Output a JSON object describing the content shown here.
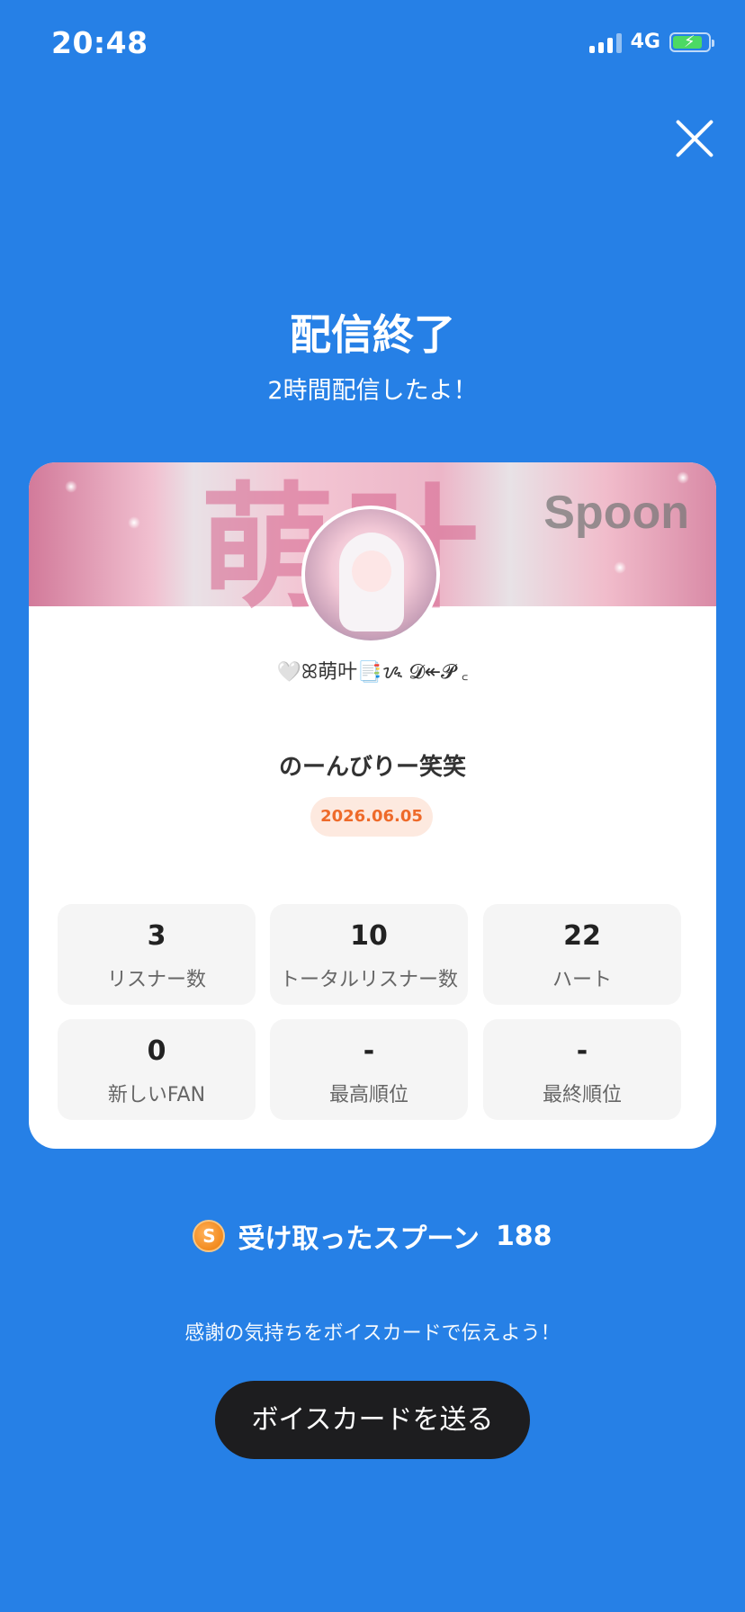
{
  "status_bar": {
    "time": "20:48",
    "network": "4G",
    "icons": [
      "signal-icon",
      "battery-charging-icon"
    ]
  },
  "header": {
    "title": "配信終了",
    "subtitle": "2時間配信したよ！"
  },
  "card": {
    "banner_text": "萌叶",
    "brand": "Spoon",
    "username": "🤍ꕤ萌叶📑ᝰ 𝓓↞𝓟 ꜀",
    "live_title": "のーんびりー笑笑",
    "date": "2026.06.05",
    "stats": [
      {
        "value": "3",
        "label": "リスナー数"
      },
      {
        "value": "10",
        "label": "トータルリスナー数"
      },
      {
        "value": "22",
        "label": "ハート"
      },
      {
        "value": "0",
        "label": "新しいFAN"
      },
      {
        "value": "-",
        "label": "最高順位"
      },
      {
        "value": "-",
        "label": "最終順位"
      }
    ]
  },
  "spoon": {
    "coin_letter": "S",
    "label": "受け取ったスプーン",
    "count": "188"
  },
  "thanks_text": "感謝の気持ちをボイスカードで伝えよう！",
  "voice_card_button": "ボイスカードを送る",
  "colors": {
    "background": "#2680e6",
    "date_badge_bg": "#fde9df",
    "date_badge_text": "#ee6a2a",
    "button_bg": "#1d1d1f"
  }
}
